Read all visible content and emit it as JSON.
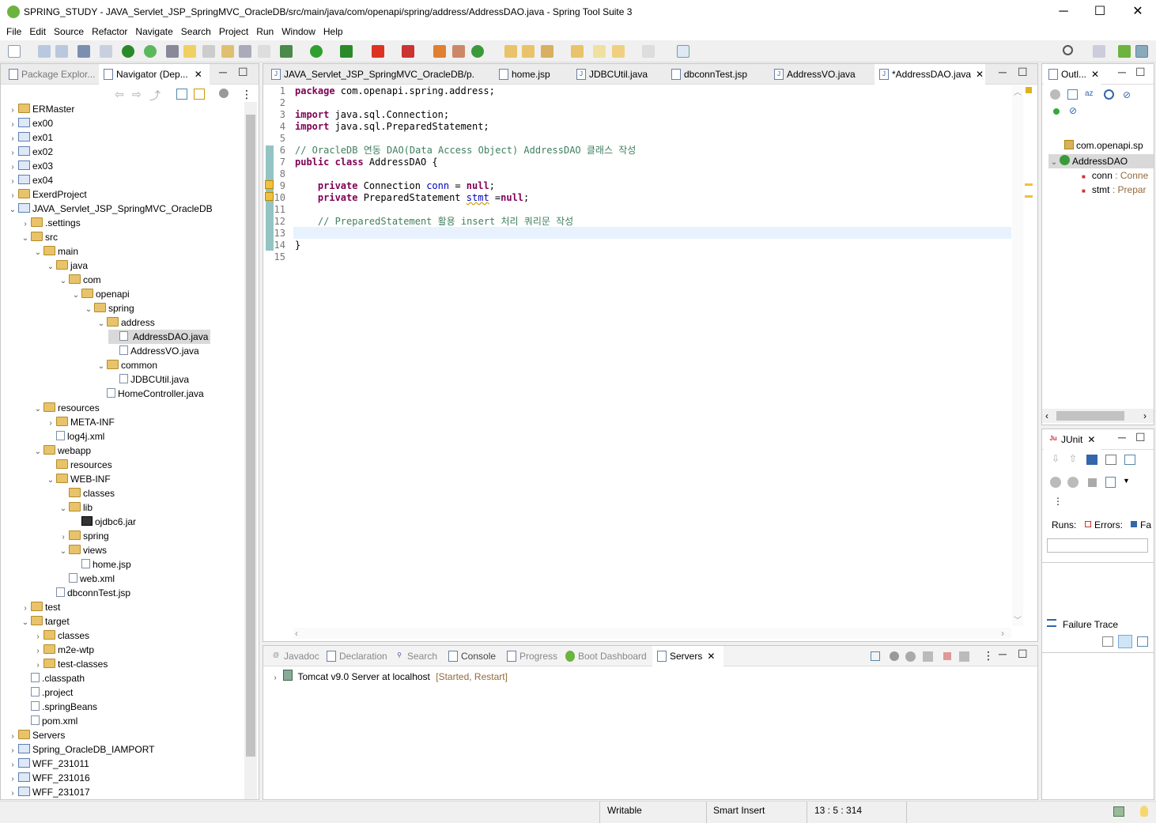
{
  "window": {
    "title": "SPRING_STUDY - JAVA_Servlet_JSP_SpringMVC_OracleDB/src/main/java/com/openapi/spring/address/AddressDAO.java - Spring Tool Suite 3",
    "minimize": "─",
    "maximize": "☐",
    "close": "✕"
  },
  "menu": [
    "File",
    "Edit",
    "Source",
    "Refactor",
    "Navigate",
    "Search",
    "Project",
    "Run",
    "Window",
    "Help"
  ],
  "left_panel": {
    "tabs": [
      "Package Explor...",
      "Navigator (Dep..."
    ],
    "tree": [
      {
        "label": "ERMaster",
        "depth": 0,
        "arrow": "›",
        "icon": "folder"
      },
      {
        "label": "ex00",
        "depth": 0,
        "arrow": "›",
        "icon": "proj"
      },
      {
        "label": "ex01",
        "depth": 0,
        "arrow": "›",
        "icon": "proj"
      },
      {
        "label": "ex02",
        "depth": 0,
        "arrow": "›",
        "icon": "proj"
      },
      {
        "label": "ex03",
        "depth": 0,
        "arrow": "›",
        "icon": "proj"
      },
      {
        "label": "ex04",
        "depth": 0,
        "arrow": "›",
        "icon": "proj"
      },
      {
        "label": "ExerdProject",
        "depth": 0,
        "arrow": "›",
        "icon": "folder"
      },
      {
        "label": "JAVA_Servlet_JSP_SpringMVC_OracleDB",
        "depth": 0,
        "arrow": "⌄",
        "icon": "proj"
      },
      {
        "label": ".settings",
        "depth": 1,
        "arrow": "›",
        "icon": "folder"
      },
      {
        "label": "src",
        "depth": 1,
        "arrow": "⌄",
        "icon": "folder"
      },
      {
        "label": "main",
        "depth": 2,
        "arrow": "⌄",
        "icon": "folder"
      },
      {
        "label": "java",
        "depth": 3,
        "arrow": "⌄",
        "icon": "folder"
      },
      {
        "label": "com",
        "depth": 4,
        "arrow": "⌄",
        "icon": "folder"
      },
      {
        "label": "openapi",
        "depth": 5,
        "arrow": "⌄",
        "icon": "folder"
      },
      {
        "label": "spring",
        "depth": 6,
        "arrow": "⌄",
        "icon": "folder"
      },
      {
        "label": "address",
        "depth": 7,
        "arrow": "⌄",
        "icon": "folder"
      },
      {
        "label": "AddressDAO.java",
        "depth": 8,
        "arrow": "",
        "icon": "file",
        "selected": true
      },
      {
        "label": "AddressVO.java",
        "depth": 8,
        "arrow": "",
        "icon": "file"
      },
      {
        "label": "common",
        "depth": 7,
        "arrow": "⌄",
        "icon": "folder"
      },
      {
        "label": "JDBCUtil.java",
        "depth": 8,
        "arrow": "",
        "icon": "file"
      },
      {
        "label": "HomeController.java",
        "depth": 7,
        "arrow": "",
        "icon": "file"
      },
      {
        "label": "resources",
        "depth": 2,
        "arrow": "⌄",
        "icon": "folder"
      },
      {
        "label": "META-INF",
        "depth": 3,
        "arrow": "›",
        "icon": "folder"
      },
      {
        "label": "log4j.xml",
        "depth": 3,
        "arrow": "",
        "icon": "file"
      },
      {
        "label": "webapp",
        "depth": 2,
        "arrow": "⌄",
        "icon": "folder"
      },
      {
        "label": "resources",
        "depth": 3,
        "arrow": "",
        "icon": "folder"
      },
      {
        "label": "WEB-INF",
        "depth": 3,
        "arrow": "⌄",
        "icon": "folder"
      },
      {
        "label": "classes",
        "depth": 4,
        "arrow": "",
        "icon": "folder"
      },
      {
        "label": "lib",
        "depth": 4,
        "arrow": "⌄",
        "icon": "folder"
      },
      {
        "label": "ojdbc6.jar",
        "depth": 5,
        "arrow": "",
        "icon": "jar"
      },
      {
        "label": "spring",
        "depth": 4,
        "arrow": "›",
        "icon": "folder"
      },
      {
        "label": "views",
        "depth": 4,
        "arrow": "⌄",
        "icon": "folder"
      },
      {
        "label": "home.jsp",
        "depth": 5,
        "arrow": "",
        "icon": "file"
      },
      {
        "label": "web.xml",
        "depth": 4,
        "arrow": "",
        "icon": "file"
      },
      {
        "label": "dbconnTest.jsp",
        "depth": 3,
        "arrow": "",
        "icon": "file"
      },
      {
        "label": "test",
        "depth": 1,
        "arrow": "›",
        "icon": "folder"
      },
      {
        "label": "target",
        "depth": 0,
        "arrow": "⌄",
        "icon": "folder",
        "offset": 1
      },
      {
        "label": "classes",
        "depth": 1,
        "arrow": "›",
        "icon": "folder",
        "offset": 1
      },
      {
        "label": "m2e-wtp",
        "depth": 1,
        "arrow": "›",
        "icon": "folder",
        "offset": 1
      },
      {
        "label": "test-classes",
        "depth": 1,
        "arrow": "›",
        "icon": "folder",
        "offset": 1
      },
      {
        "label": ".classpath",
        "depth": 0,
        "arrow": "",
        "icon": "file",
        "offset": 1
      },
      {
        "label": ".project",
        "depth": 0,
        "arrow": "",
        "icon": "file",
        "offset": 1
      },
      {
        "label": ".springBeans",
        "depth": 0,
        "arrow": "",
        "icon": "file",
        "offset": 1
      },
      {
        "label": "pom.xml",
        "depth": 0,
        "arrow": "",
        "icon": "file",
        "offset": 1
      },
      {
        "label": "Servers",
        "depth": 0,
        "arrow": "›",
        "icon": "folder"
      },
      {
        "label": "Spring_OracleDB_IAMPORT",
        "depth": 0,
        "arrow": "›",
        "icon": "proj"
      },
      {
        "label": "WFF_231011",
        "depth": 0,
        "arrow": "›",
        "icon": "proj"
      },
      {
        "label": "WFF_231016",
        "depth": 0,
        "arrow": "›",
        "icon": "proj"
      },
      {
        "label": "WFF_231017",
        "depth": 0,
        "arrow": "›",
        "icon": "proj"
      }
    ]
  },
  "editor": {
    "tabs": [
      "JAVA_Servlet_JSP_SpringMVC_OracleDB/p...",
      "home.jsp",
      "JDBCUtil.java",
      "dbconnTest.jsp",
      "AddressVO.java",
      "*AddressDAO.java"
    ],
    "line_numbers": [
      "1",
      "2",
      "3",
      "4",
      "5",
      "6",
      "7",
      "8",
      "9",
      "10",
      "11",
      "12",
      "13",
      "14",
      "15"
    ],
    "code": {
      "l1a": "package",
      "l1b": " com.openapi.spring.address;",
      "l3a": "import",
      "l3b": " java.sql.Connection;",
      "l4a": "import",
      "l4b": " java.sql.PreparedStatement;",
      "l6": "// OracleDB 연동 DAO(Data Access Object) AddressDAO 클래스 작성",
      "l7a": "public class",
      "l7b": " AddressDAO {",
      "l9a": "    private",
      "l9b": " Connection ",
      "l9c": "conn",
      "l9d": " = ",
      "l9e": "null",
      "l9f": ";",
      "l10a": "    private",
      "l10b": " PreparedStatement ",
      "l10c": "stmt",
      "l10d": " =",
      "l10e": "null",
      "l10f": ";",
      "l12": "    // PreparedStatement 활용 insert 처리 쿼리문 작성",
      "l14": "}"
    }
  },
  "outline": {
    "tab": "Outl...",
    "items": [
      "com.openapi.sp",
      "AddressDAO",
      "conn",
      "stmt"
    ],
    "types": [
      ": Conne",
      ": Prepar"
    ]
  },
  "junit": {
    "tab": "JUnit",
    "runs": "Runs:",
    "errors": "Errors:",
    "failures": "Fa",
    "failure_trace": "Failure Trace"
  },
  "bottom": {
    "tabs": [
      "Javadoc",
      "Declaration",
      "Search",
      "Console",
      "Progress",
      "Boot Dashboard",
      "Servers"
    ],
    "server": "Tomcat v9.0 Server at localhost",
    "state": "[Started, Restart]"
  },
  "status": {
    "writable": "Writable",
    "insert_mode": "Smart Insert",
    "position": "13 : 5 : 314"
  }
}
